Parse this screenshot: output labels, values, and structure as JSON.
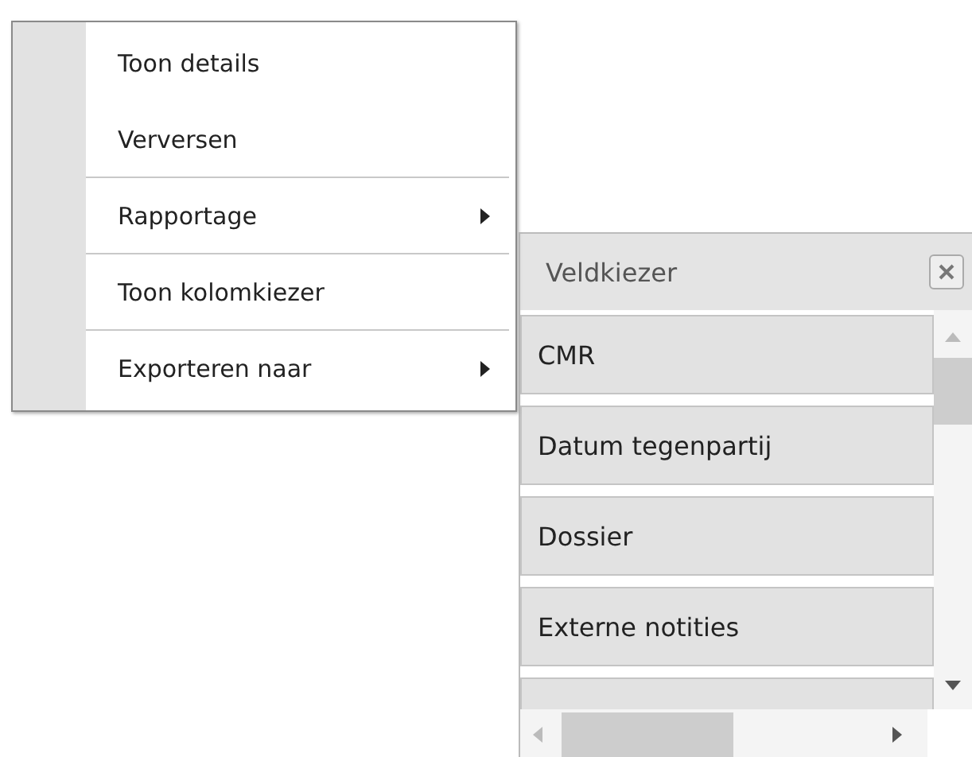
{
  "context_menu": {
    "items": [
      {
        "label": "Toon details",
        "submenu": false,
        "separator_after": false
      },
      {
        "label": "Verversen",
        "submenu": false,
        "separator_after": true
      },
      {
        "label": "Rapportage",
        "submenu": true,
        "separator_after": true
      },
      {
        "label": "Toon kolomkiezer",
        "submenu": false,
        "separator_after": true
      },
      {
        "label": "Exporteren naar",
        "submenu": true,
        "separator_after": false
      }
    ]
  },
  "field_chooser": {
    "title": "Veldkiezer",
    "fields": [
      "CMR",
      "Datum tegenpartij",
      "Dossier",
      "Externe notities"
    ]
  }
}
